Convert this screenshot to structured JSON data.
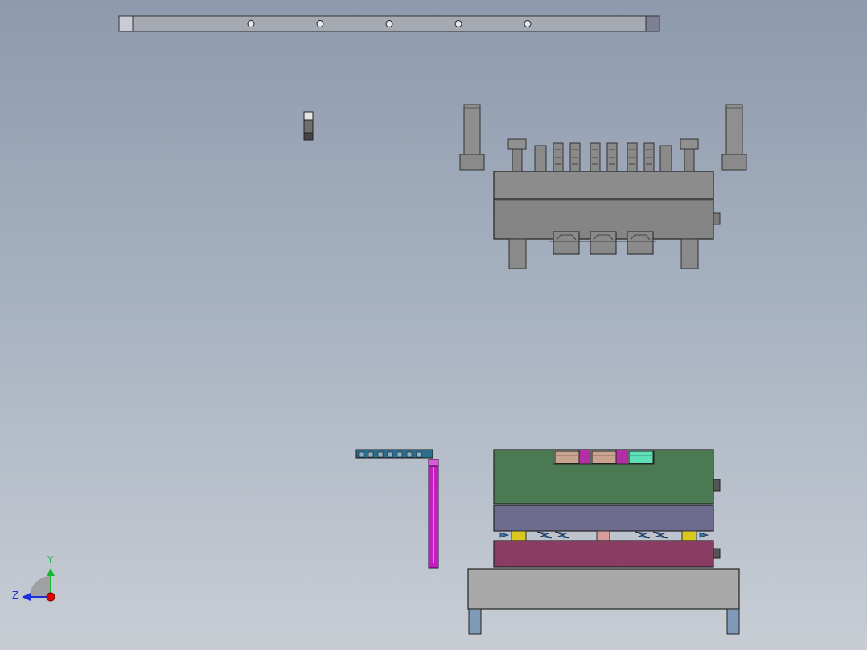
{
  "viewport": {
    "background_top": "#8e9aad",
    "background_bottom": "#c8cdd4"
  },
  "triad": {
    "y_label": "Y",
    "z_label": "Z",
    "y_color": "#19b832",
    "z_color": "#1c2fe0",
    "x_color": "#e00000"
  },
  "colors": {
    "steel": "#8d8d8d",
    "steel_dark": "#5e5e5e",
    "rail": "#a7aab3",
    "cavity_plate": "#4b7a52",
    "core_plate": "#6e6c8e",
    "support_plate": "#8a3d62",
    "base_plate": "#a9a9a9",
    "foot": "#7f9ab8",
    "magenta_pin": "#c41fc4",
    "cyan_insert": "#5de0b8",
    "tan_insert": "#c8a48e",
    "spring_blue": "#3a74a8",
    "yellow_pillar": "#d8c820",
    "pink_pillar": "#d89a9a"
  }
}
